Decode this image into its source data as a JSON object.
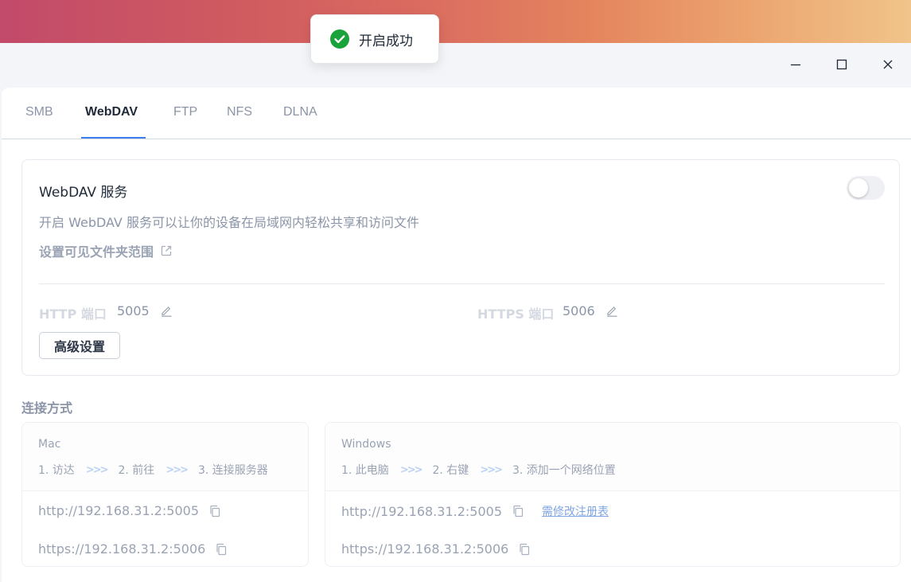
{
  "window": {
    "controls": [
      "minimize",
      "maximize",
      "close"
    ]
  },
  "tabs": [
    {
      "label": "SMB",
      "active": false
    },
    {
      "label": "WebDAV",
      "active": true
    },
    {
      "label": "FTP",
      "active": false
    },
    {
      "label": "NFS",
      "active": false
    },
    {
      "label": "DLNA",
      "active": false
    }
  ],
  "service": {
    "title": "WebDAV 服务",
    "enabled": false,
    "description": "开启 WebDAV 服务可以让你的设备在局域网内轻松共享和访问文件",
    "visible_folders_link": "设置可见文件夹范围",
    "http_port_label": "HTTP 端口",
    "http_port": "5005",
    "https_port_label": "HTTPS 端口",
    "https_port": "5006",
    "advanced_button": "高级设置"
  },
  "connection": {
    "title": "连接方式",
    "mac": {
      "os": "Mac",
      "steps": [
        "1. 访达",
        "2. 前往",
        "3. 连接服务器"
      ],
      "http_url": "http://192.168.31.2:5005",
      "https_url": "https://192.168.31.2:5006"
    },
    "windows": {
      "os": "Windows",
      "steps": [
        "1. 此电脑",
        "2. 右键",
        "3. 添加一个网络位置"
      ],
      "http_url": "http://192.168.31.2:5005",
      "registry_link": "需修改注册表",
      "https_url": "https://192.168.31.2:5006"
    }
  },
  "toast": {
    "message": "开启成功",
    "icon": "check-circle-icon",
    "color": "#19a33a"
  },
  "colors": {
    "accent": "#3b7ff0",
    "muted": "#8b95a7"
  }
}
